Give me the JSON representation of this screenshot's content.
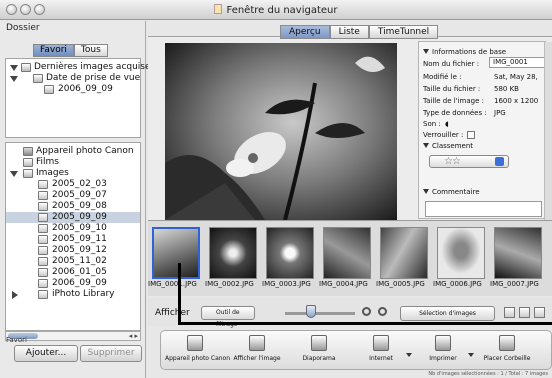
{
  "window": {
    "title": "Fenêtre du navigateur"
  },
  "sidebar": {
    "heading": "Dossier",
    "segments": [
      "Favori",
      "Tous"
    ],
    "favorites_tree": [
      {
        "label": "Dernières images acquises"
      },
      {
        "label": "Date de prise de vue"
      },
      {
        "label": "2006_09_09"
      }
    ],
    "all_tree": [
      {
        "label": "Appareil photo Canon"
      },
      {
        "label": "Films"
      },
      {
        "label": "Images"
      },
      {
        "label": "2005_02_03"
      },
      {
        "label": "2005_09_07"
      },
      {
        "label": "2005_09_08"
      },
      {
        "label": "2005_09_09"
      },
      {
        "label": "2005_09_10"
      },
      {
        "label": "2005_09_11"
      },
      {
        "label": "2005_09_12"
      },
      {
        "label": "2005_11_02"
      },
      {
        "label": "2006_01_05"
      },
      {
        "label": "2006_09_09"
      },
      {
        "label": "iPhoto Library"
      }
    ],
    "favorites_label": "Favori",
    "add_button": "Ajouter...",
    "delete_button": "Supprimer"
  },
  "tabs": [
    "Aperçu",
    "Liste",
    "TimeTunnel"
  ],
  "info": {
    "section_basic": "Informations de base",
    "rows": [
      {
        "k": "Nom du fichier :",
        "v": "IMG_0001"
      },
      {
        "k": "Modifié le :",
        "v": "Sat, May 28,"
      },
      {
        "k": "Taille du fichier :",
        "v": "580 KB"
      },
      {
        "k": "Taille de l'image :",
        "v": "1600 x 1200"
      },
      {
        "k": "Type de données :",
        "v": "JPG"
      },
      {
        "k": "Son :",
        "v": ""
      },
      {
        "k": "Verrouiller :",
        "v": ""
      }
    ],
    "section_rating": "Classement",
    "stars": "☆☆",
    "section_comment": "Commentaire"
  },
  "thumbnails": [
    "IMG_0001.JPG",
    "IMG_0002.JPG",
    "IMG_0003.JPG",
    "IMG_0004.JPG",
    "IMG_0005.JPG",
    "IMG_0006.JPG",
    "IMG_0007.JPG"
  ],
  "viewbar": {
    "afficher": "Afficher",
    "filter": "Outil de filtrage",
    "selection": "Sélection d'images"
  },
  "toolbar": [
    "Appareil photo Canon",
    "Afficher l'image",
    "Diaporama",
    "Internet",
    "Imprimer",
    "Placer Corbeille"
  ],
  "status": "Nb d'images sélectionnées : 1 / Total : 7 images"
}
